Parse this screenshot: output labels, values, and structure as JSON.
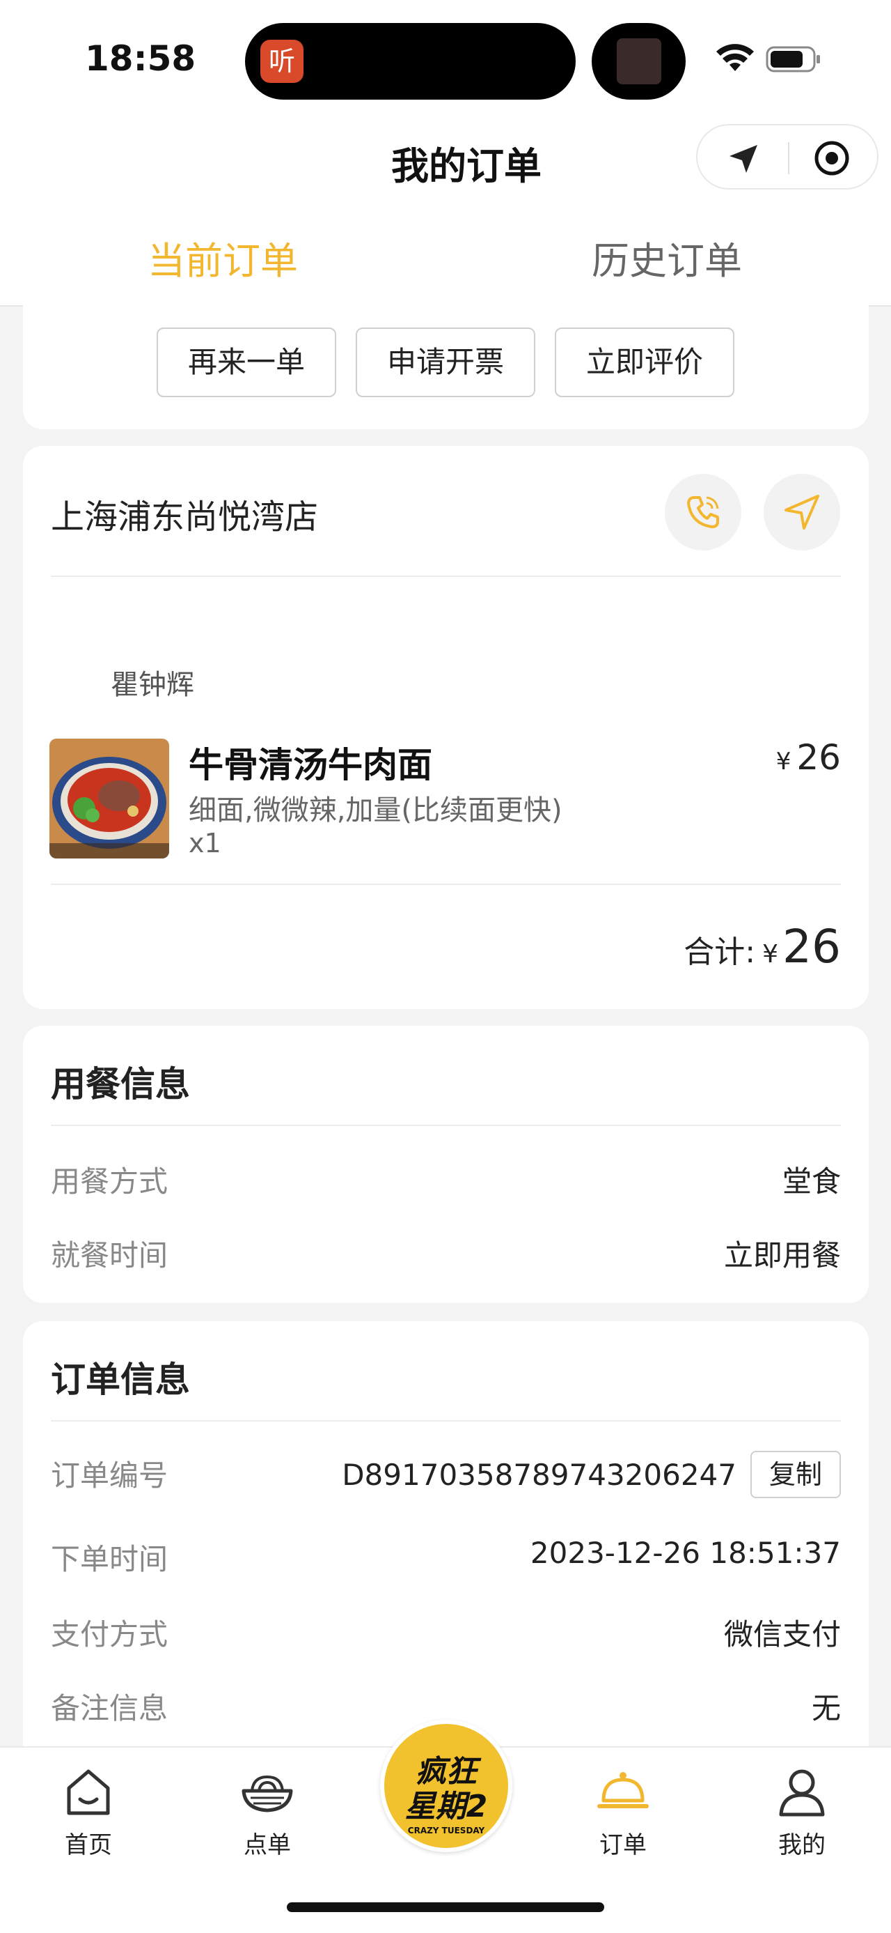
{
  "status_bar": {
    "time": "18:58",
    "island_app_glyph": "听"
  },
  "header": {
    "title": "我的订单"
  },
  "tabs": [
    {
      "label": "当前订单",
      "active": true
    },
    {
      "label": "历史订单",
      "active": false
    }
  ],
  "actions": {
    "reorder": "再来一单",
    "invoice": "申请开票",
    "review": "立即评价"
  },
  "store": {
    "name": "上海浦东尚悦湾店",
    "customer": "瞿钟辉",
    "item": {
      "name": "牛骨清汤牛肉面",
      "spec": "细面,微微辣,加量(比续面更快)",
      "qty": "x1",
      "currency": "¥",
      "price": "26"
    },
    "total_label": "合计:",
    "total_currency": "¥",
    "total_amount": "26"
  },
  "dining": {
    "title": "用餐信息",
    "method_label": "用餐方式",
    "method_value": "堂食",
    "time_label": "就餐时间",
    "time_value": "立即用餐"
  },
  "order": {
    "title": "订单信息",
    "id_label": "订单编号",
    "id_value": "D891703587897432062​47",
    "copy_label": "复制",
    "time_label": "下单时间",
    "time_value": "2023-12-26 18:51:37",
    "pay_label": "支付方式",
    "pay_value": "微信支付",
    "note_label": "备注信息",
    "note_value": "无"
  },
  "nav": {
    "home": "首页",
    "menu": "点单",
    "logo_line1": "疯狂",
    "logo_line2": "星期2",
    "logo_sub": "CRAZY TUESDAY",
    "orders": "订单",
    "mine": "我的"
  },
  "colors": {
    "accent": "#f2c12e",
    "tab_active": "#f2b72e"
  }
}
